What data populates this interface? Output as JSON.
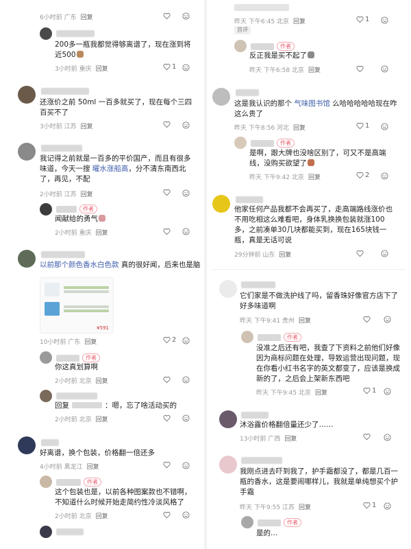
{
  "left": {
    "c1_meta_time": "6小时前 广东",
    "c1_reply": "回复",
    "c2_text": "200多一瓶我都觉得够离谱了，现在涨到将近500",
    "c2_meta_time": "3小时前 重庆",
    "c2_reply": "回复",
    "c2_likes": "1",
    "c3_text": "还涨价之前 50ml 一百多就买了，现在每个三四百买不了",
    "c3_meta_time": "3小时前 江苏",
    "c3_reply": "回复",
    "c4_text_a": "我记得之前就是一百多的平价国产，而且有很多味道，今天一搜 ",
    "c4_link": "曜水涨船高",
    "c4_text_b": "，分不清东南西北了，再见，不配",
    "c4_meta_time": "2小时前 江苏",
    "c4_reply": "回复",
    "c5_author": "作者",
    "c5_text": "闻献给的勇气",
    "c5_meta_time": "2小时前 重庆",
    "c5_reply": "回复",
    "c6_link": "以前那个颜色香水白色款",
    "c6_text": " 真的很好闻，后来也是脑",
    "c6_meta_time": "10小时前 广东",
    "c6_reply": "回复",
    "c6_likes": "2",
    "c6_thumb_price": "¥591",
    "c7_author": "作者",
    "c7_text": "你这真划算啊",
    "c7_meta_time": "2小时前 北京",
    "c7_reply": "回复",
    "c8_prefix": "回复",
    "c8_text": "：嗯，忘了啥活动买的",
    "c8_meta_time": "2小时前 北京",
    "c8_reply": "回复",
    "c9_text": "好离谱，换个包装，价格翻一倍还多",
    "c9_meta_time": "4小时前 黑龙江",
    "c9_reply": "回复",
    "c10_author": "作者",
    "c10_text": "这个包装也是，以前各种图案款也不错啊，不知道什么时候开始走简约性冷淡风格了",
    "c10_meta_time": "2小时前 北京",
    "c10_reply": "回复"
  },
  "right": {
    "r1_meta_time": "昨天 下午6:45 北京",
    "r1_reply": "回复",
    "r1_likes": "1",
    "r1_tag": "首评",
    "r2_author": "作者",
    "r2_text": "反正我是买不起了",
    "r2_meta_time": "昨天 下午6:58 北京",
    "r2_reply": "回复",
    "r3_text_a": "这是我认识的那个 ",
    "r3_link": "气味图书馆",
    "r3_text_b": " 么哈哈哈哈哈现在咋这么贵了",
    "r3_meta_time": "昨天 下午8:56 河北",
    "r3_reply": "回复",
    "r3_likes": "1",
    "r4_author": "作者",
    "r4_text": "是啊，跟大牌也没啥区别了，可又不是高端线，没购买欲望了",
    "r4_meta_time": "昨天 下午9:42 北京",
    "r4_reply": "回复",
    "r4_likes": "2",
    "r5_text": "他家任何产品我都不会再买了，走高端路线涨价也不用吃相这么难看吧，身体乳换换包装就涨100多，之前凑单30几块都能买到，现在165块钱一瓶，真是无话可说",
    "r5_meta_time": "29分钟前 山东",
    "r5_reply": "回复",
    "r6_text": "它们家是不做洗护线了吗，留香珠好像官方店下了好多味道啊",
    "r6_meta_time": "昨天 下午9:41 贵州",
    "r6_reply": "回复",
    "r7_author": "作者",
    "r7_text": "没准之后还有吧，我查了下资料之前他们好像因为商标问题在处理，导致运营出现问题，现在你看小红书名字的英文都变了，应该是换成新的了，之后会上架新东西吧",
    "r7_meta_time": "昨天 下午9:45 北京",
    "r7_reply": "回复",
    "r7_likes": "1",
    "r8_text": "沐浴露价格翻倍量还少了……",
    "r8_meta_time": "13小时前 广西",
    "r8_reply": "回复",
    "r9_text": "我刚点进去吓到我了，护手霜都没了，都是几百一瓶的香水，这是要闹哪样儿，我就是单纯想买个护手霜",
    "r9_meta_time": "昨天 下午9:55 江苏",
    "r9_reply": "回复",
    "r9_likes": "1",
    "r10_author": "作者",
    "r10_text": "是的…"
  },
  "icons": {
    "heart": "heart-outline-icon",
    "comment": "smile-face-icon"
  }
}
